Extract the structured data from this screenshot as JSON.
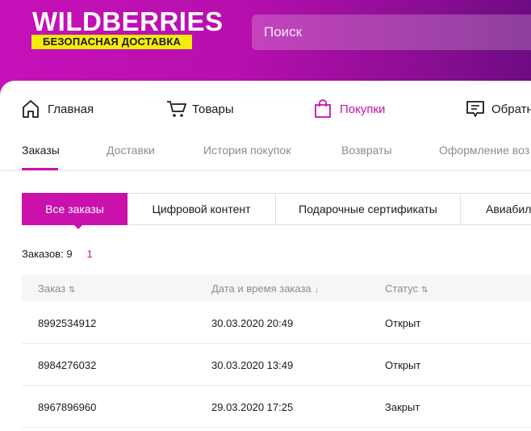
{
  "brand": {
    "name": "WILDBERRIES",
    "badge": "БЕЗОПАСНАЯ ДОСТАВКА",
    "colors": {
      "accent": "#cb11ab",
      "badge": "#f3ec0b"
    }
  },
  "search": {
    "placeholder": "Поиск"
  },
  "nav": {
    "items": [
      {
        "label": "Главная",
        "icon": "home-icon"
      },
      {
        "label": "Товары",
        "icon": "cart-icon"
      },
      {
        "label": "Покупки",
        "icon": "shopping-bag-icon",
        "active": true
      },
      {
        "label": "Обратн",
        "icon": "feedback-icon"
      }
    ]
  },
  "subtabs": [
    {
      "label": "Заказы",
      "active": true
    },
    {
      "label": "Доставки"
    },
    {
      "label": "История покупок"
    },
    {
      "label": "Возвраты"
    },
    {
      "label": "Оформление воз"
    }
  ],
  "segments": [
    {
      "label": "Все заказы",
      "active": true
    },
    {
      "label": "Цифровой контент"
    },
    {
      "label": "Подарочные сертификаты"
    },
    {
      "label": "Авиабил"
    }
  ],
  "orders": {
    "count_label": "Заказов: 9",
    "page": "1",
    "columns": [
      {
        "label": "Заказ",
        "sort": "⇅"
      },
      {
        "label": "Дата и время заказа",
        "sort": "↓"
      },
      {
        "label": "Статус",
        "sort": "⇅"
      }
    ],
    "rows": [
      {
        "id": "8992534912",
        "datetime": "30.03.2020 20:49",
        "status": "Открыт"
      },
      {
        "id": "8984276032",
        "datetime": "30.03.2020 13:49",
        "status": "Открыт"
      },
      {
        "id": "8967896960",
        "datetime": "29.03.2020 17:25",
        "status": "Закрыт"
      }
    ]
  }
}
